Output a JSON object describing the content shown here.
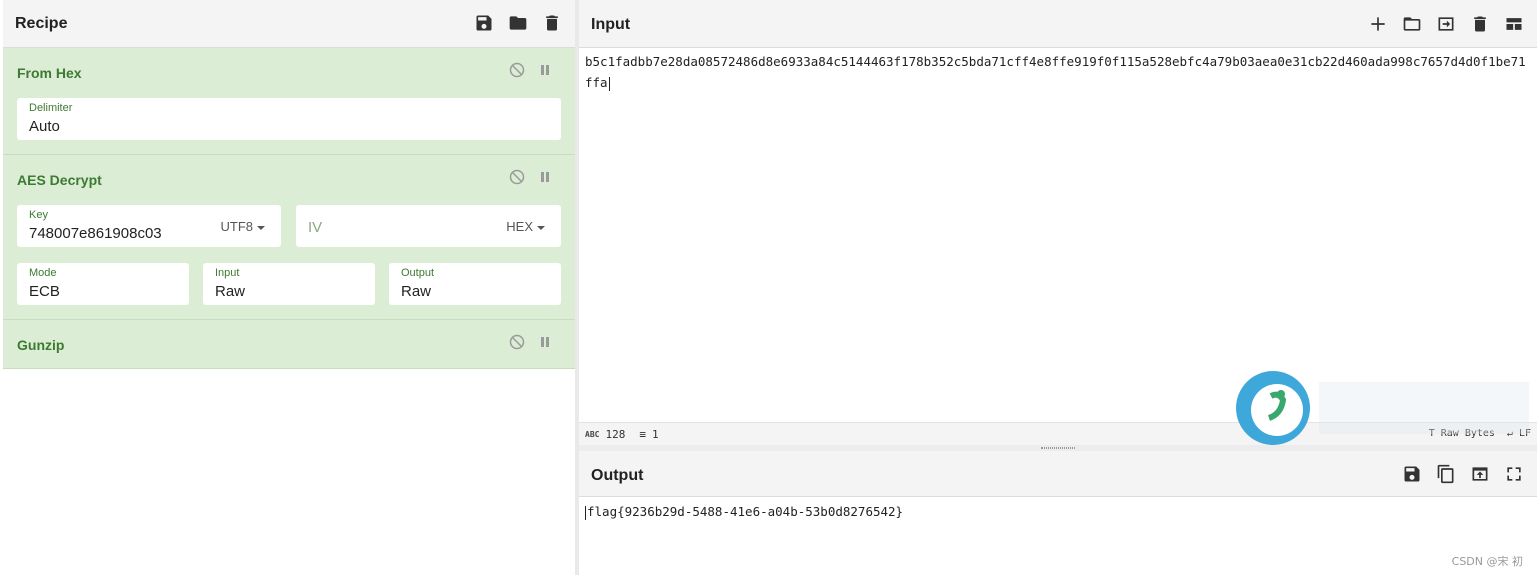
{
  "recipe": {
    "title": "Recipe",
    "operations": [
      {
        "name": "From Hex",
        "args": [
          {
            "label": "Delimiter",
            "value": "Auto"
          }
        ]
      },
      {
        "name": "AES Decrypt",
        "args": [
          {
            "label": "Key",
            "value": "748007e861908c03",
            "encoding": "UTF8"
          },
          {
            "label": "",
            "placeholder": "IV",
            "encoding": "HEX"
          },
          {
            "label": "Mode",
            "value": "ECB"
          },
          {
            "label": "Input",
            "value": "Raw"
          },
          {
            "label": "Output",
            "value": "Raw"
          }
        ]
      },
      {
        "name": "Gunzip",
        "args": []
      }
    ]
  },
  "input": {
    "title": "Input",
    "text": "b5c1fadbb7e28da08572486d8e6933a84c5144463f178b352c5bda71cff4e8ffe919f0f115a528ebfc4a79b03aea0e31cb22d460ada998c7657d4d0f1be71ffa",
    "status": {
      "length": "128",
      "lines": "1",
      "format": "Raw Bytes",
      "eol": "LF"
    }
  },
  "output": {
    "title": "Output",
    "text": "flag{9236b29d-5488-41e6-a04b-53b0d8276542}"
  },
  "watermark": "CSDN @宋 初",
  "icons": {
    "recipe_header": [
      "save-icon",
      "folder-icon",
      "trash-icon"
    ],
    "input_header": [
      "plus-icon",
      "folder-icon",
      "import-icon",
      "trash-icon",
      "layout-icon"
    ],
    "output_header": [
      "save-icon",
      "copy-icon",
      "replace-input-icon",
      "fullscreen-icon"
    ]
  }
}
